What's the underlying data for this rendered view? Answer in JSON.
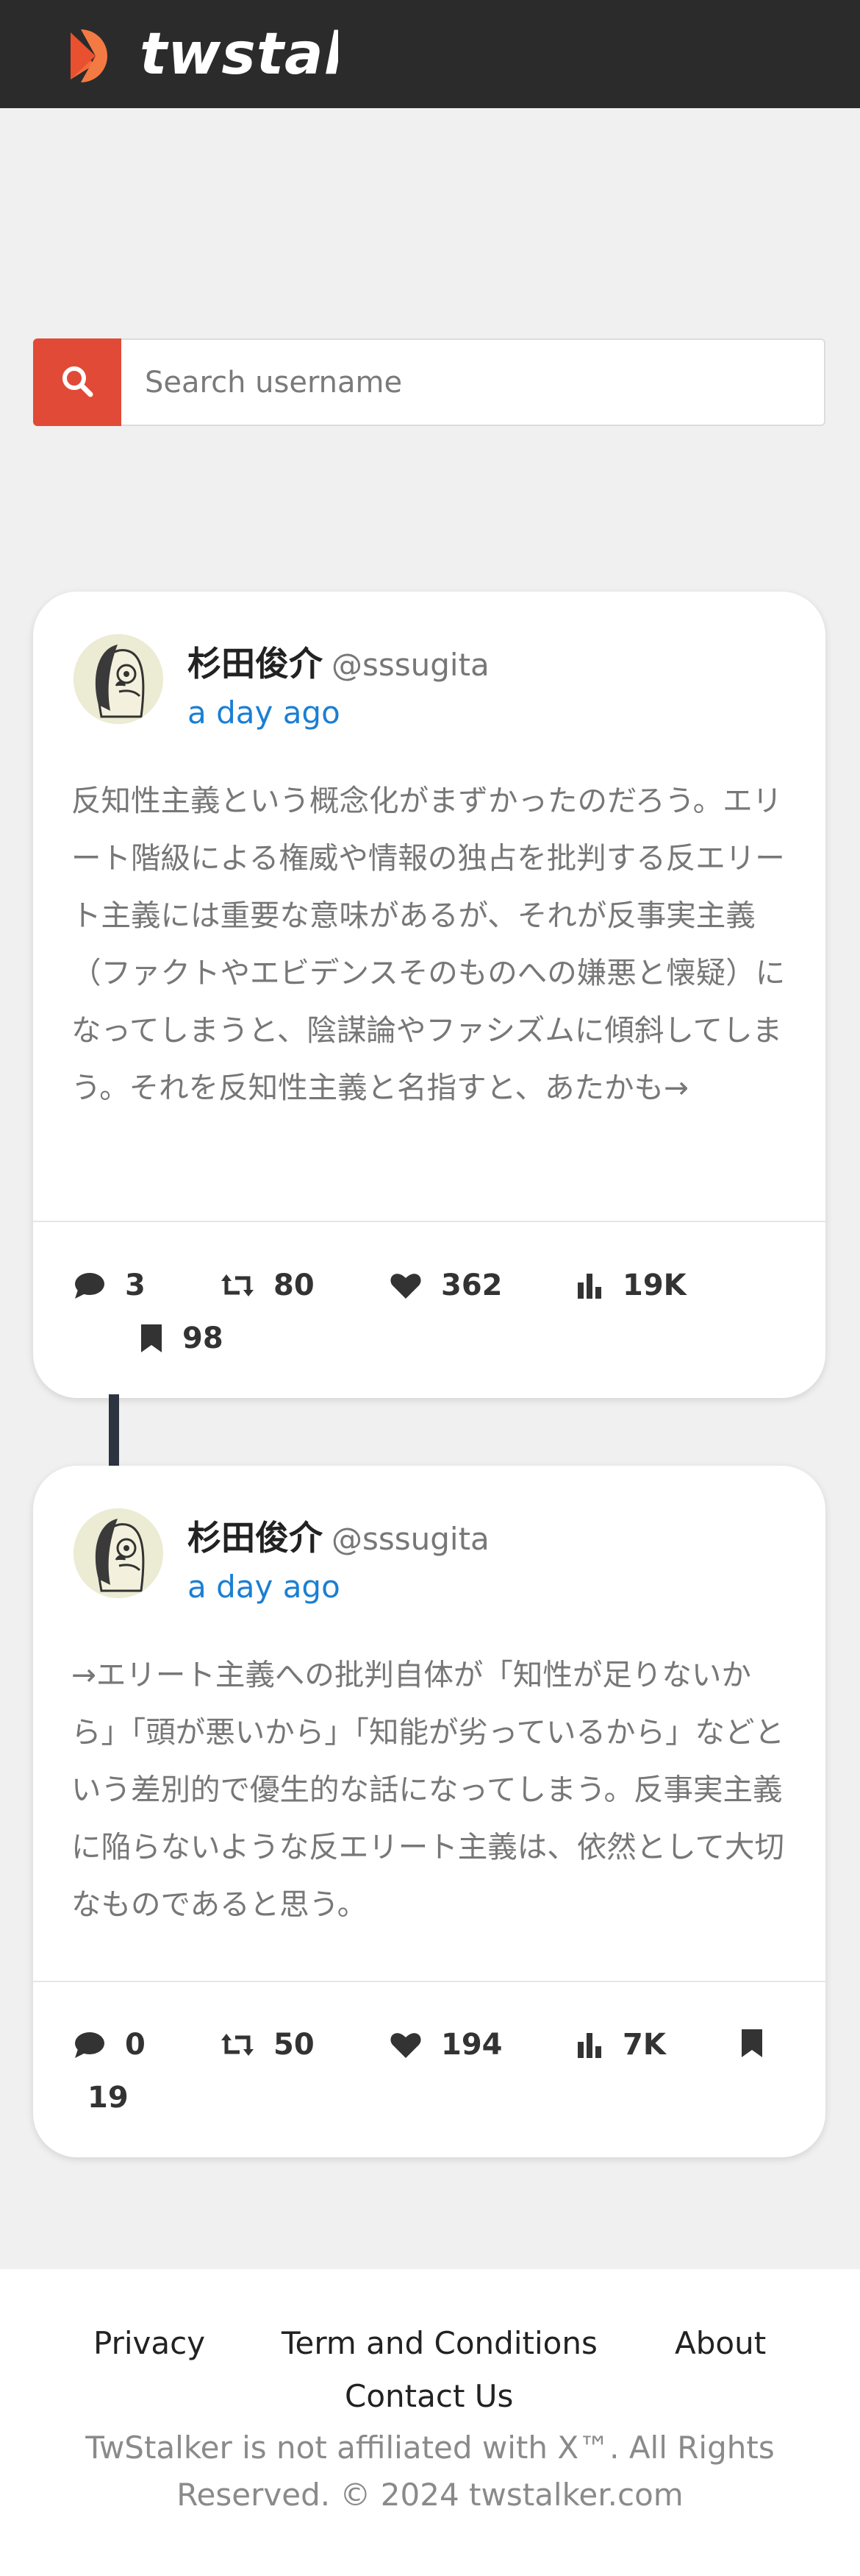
{
  "header": {
    "brand": "twstalker"
  },
  "search": {
    "placeholder": "Search username"
  },
  "tweets": [
    {
      "name": "杉田俊介",
      "handle": "@sssugita",
      "time": "a day ago",
      "text": "反知性主義という概念化がまずかったのだろう。エリート階級による権威や情報の独占を批判する反エリート主義には重要な意味があるが、それが反事実主義（ファクトやエビデンスそのものへの嫌悪と懐疑）になってしまうと、陰謀論やファシズムに傾斜してしまう。それを反知性主義と名指すと、あたかも→",
      "stats": {
        "replies": "3",
        "retweets": "80",
        "likes": "362",
        "views": "19K",
        "bookmarks": "98"
      }
    },
    {
      "name": "杉田俊介",
      "handle": "@sssugita",
      "time": "a day ago",
      "text": "→エリート主義への批判自体が「知性が足りないから」「頭が悪いから」「知能が劣っているから」などという差別的で優生的な話になってしまう。反事実主義に陥らないような反エリート主義は、依然として大切なものであると思う。",
      "stats": {
        "replies": "0",
        "retweets": "50",
        "likes": "194",
        "views": "7K",
        "bookmarks": "19"
      }
    }
  ],
  "footer": {
    "links": [
      "Privacy",
      "Term and Conditions",
      "About",
      "Contact Us"
    ],
    "copyright_line1": "TwStalker is not affiliated with X™. All Rights",
    "copyright_line2": "Reserved. © 2024 twstalker.com"
  },
  "icons": {
    "logo": "twstalker-logo-icon",
    "search": "search-icon",
    "reply": "comment-icon",
    "retweet": "retweet-icon",
    "like": "heart-icon",
    "views": "bar-chart-icon",
    "bookmark": "bookmark-icon"
  },
  "colors": {
    "topbar": "#2b2b2b",
    "accent": "#e14a36",
    "link": "#1a7fd4",
    "thread_line": "#2c3440"
  }
}
